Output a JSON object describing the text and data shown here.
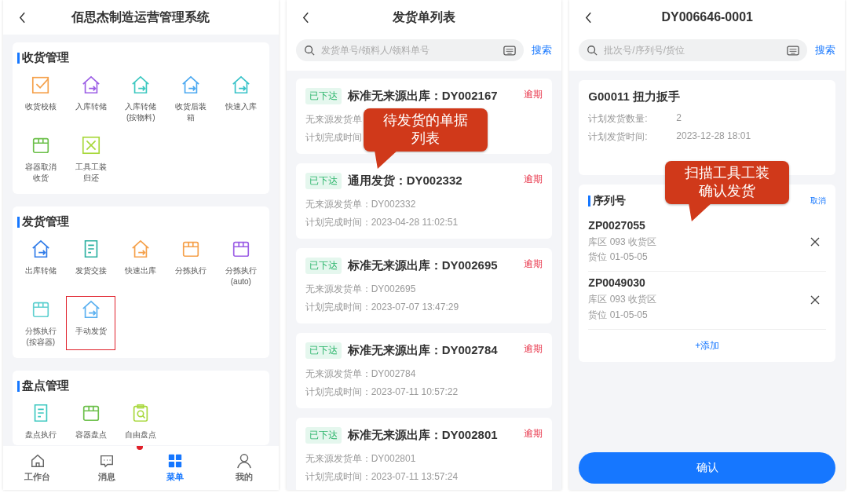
{
  "menu_screen": {
    "title": "佰思杰制造运营管理系统",
    "sections": [
      {
        "title": "收货管理",
        "items": [
          {
            "label": "收货校核",
            "kind": "check",
            "color": "#f5a04a",
            "highlighted": false
          },
          {
            "label": "入库转储",
            "kind": "house",
            "color": "#9b5de5",
            "highlighted": false
          },
          {
            "label": "入库转储(按物料)",
            "kind": "house",
            "color": "#3cc8c0",
            "highlighted": false
          },
          {
            "label": "收货后装箱",
            "kind": "house",
            "color": "#4aa8f0",
            "highlighted": false
          },
          {
            "label": "快速入库",
            "kind": "house",
            "color": "#36c2c8",
            "highlighted": false
          },
          {
            "label": "容器取消收货",
            "kind": "box",
            "color": "#6cc04a",
            "highlighted": false
          },
          {
            "label": "工具工装归还",
            "kind": "tools",
            "color": "#a8d83c",
            "highlighted": false
          }
        ]
      },
      {
        "title": "发货管理",
        "items": [
          {
            "label": "出库转储",
            "kind": "house",
            "color": "#2f7be8",
            "highlighted": false
          },
          {
            "label": "发货交接",
            "kind": "doc",
            "color": "#2bb0a0",
            "highlighted": false
          },
          {
            "label": "快速出库",
            "kind": "house",
            "color": "#f5a04a",
            "highlighted": false
          },
          {
            "label": "分拣执行",
            "kind": "box",
            "color": "#f5a04a",
            "highlighted": false
          },
          {
            "label": "分拣执行(auto)",
            "kind": "box",
            "color": "#9b5de5",
            "highlighted": false
          },
          {
            "label": "分拣执行(按容器)",
            "kind": "box",
            "color": "#5fd0d0",
            "highlighted": false
          },
          {
            "label": "手动发货",
            "kind": "house",
            "color": "#5ab0f0",
            "highlighted": true
          }
        ]
      },
      {
        "title": "盘点管理",
        "items": [
          {
            "label": "盘点执行",
            "kind": "doc",
            "color": "#3cc8c0",
            "highlighted": false
          },
          {
            "label": "容器盘点",
            "kind": "box",
            "color": "#6cc04a",
            "highlighted": false
          },
          {
            "label": "自由盘点",
            "kind": "clipboard",
            "color": "#a8d83c",
            "highlighted": false
          }
        ]
      }
    ],
    "notification_dot": true,
    "tabs": [
      {
        "label": "工作台",
        "kind": "home",
        "selected": false
      },
      {
        "label": "消息",
        "kind": "chat",
        "selected": false
      },
      {
        "label": "菜单",
        "kind": "grid",
        "selected": true
      },
      {
        "label": "我的",
        "kind": "user",
        "selected": false
      }
    ]
  },
  "list_screen": {
    "title": "发货单列表",
    "search": {
      "placeholder": "发货单号/领料人/领料单号",
      "button": "搜索"
    },
    "orders": [
      {
        "status": "已下达",
        "title": "标准无来源出库：DY002167",
        "source": "无来源发货单",
        "time": "计划完成时间",
        "flag": "逾期"
      },
      {
        "status": "已下达",
        "title": "通用发货：DY002332",
        "source": "无来源发货单：DY002332",
        "time": "计划完成时间：2023-04-28 11:02:51",
        "flag": "逾期"
      },
      {
        "status": "已下达",
        "title": "标准无来源出库：DY002695",
        "source": "无来源发货单：DY002695",
        "time": "计划完成时间：2023-07-07 13:47:29",
        "flag": "逾期"
      },
      {
        "status": "已下达",
        "title": "标准无来源出库：DY002784",
        "source": "无来源发货单：DY002784",
        "time": "计划完成时间：2023-07-11 10:57:22",
        "flag": "逾期"
      },
      {
        "status": "已下达",
        "title": "标准无来源出库：DY002801",
        "source": "无来源发货单：DY002801",
        "time": "计划完成时间：2023-07-11 13:57:24",
        "flag": "逾期"
      }
    ],
    "callout": "待发货的单据列表"
  },
  "detail_screen": {
    "title": "DY006646-0001",
    "search": {
      "placeholder": "批次号/序列号/货位",
      "button": "搜索"
    },
    "item": {
      "name": "G00011 扭力扳手",
      "fields": [
        {
          "label": "计划发货数量:",
          "value": "2"
        },
        {
          "label": "计划发货时间:",
          "value": "2023-12-28 18:01"
        }
      ]
    },
    "serials": {
      "title": "序列号",
      "cancel": "取消",
      "rows": [
        {
          "code": "ZP0027055",
          "area": "库区 093 收货区",
          "location": "货位 01-05-05"
        },
        {
          "code": "ZP0049030",
          "area": "库区 093 收货区",
          "location": "货位 01-05-05"
        }
      ],
      "add": "+添加"
    },
    "confirm": "确认",
    "callout": "扫描工具工装确认发货"
  }
}
